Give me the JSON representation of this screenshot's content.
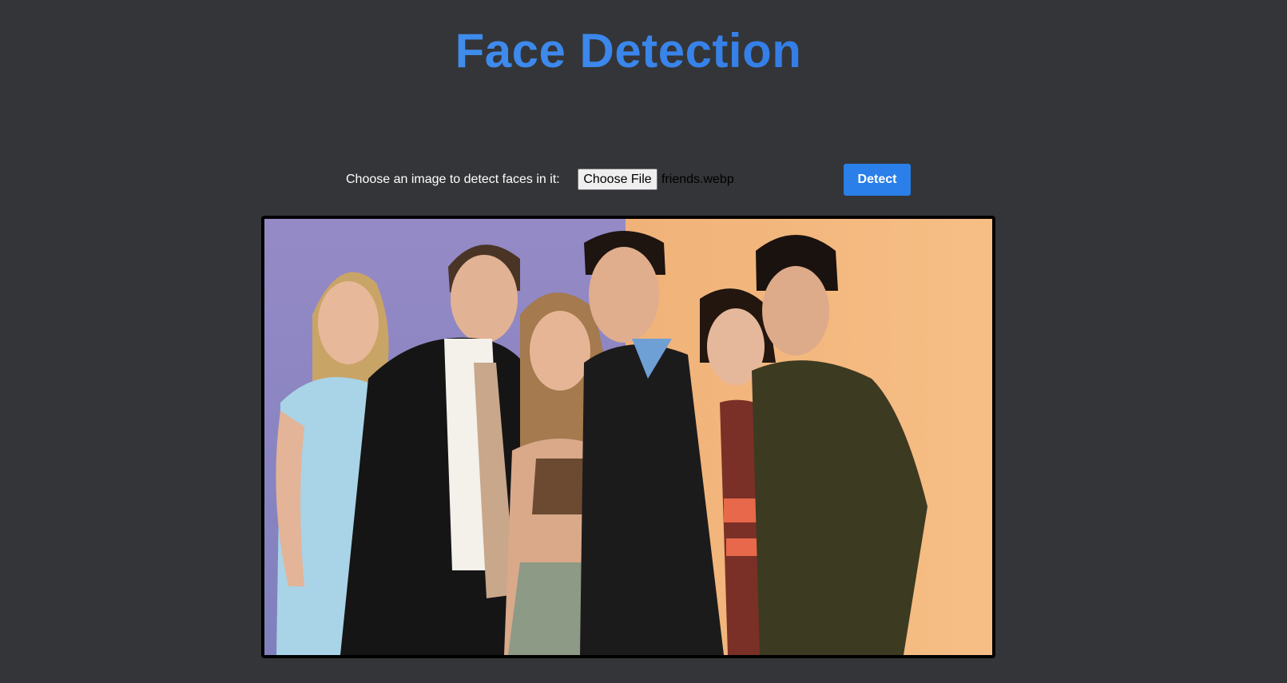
{
  "page": {
    "title": "Face Detection"
  },
  "form": {
    "prompt_label": "Choose an image to detect faces in it:",
    "choose_file_label": "Choose File",
    "selected_file": "friends.webp",
    "detect_label": "Detect"
  },
  "colors": {
    "background": "#343538",
    "title_gradient_start": "#4f9bf0",
    "title_gradient_end": "#1f66d9",
    "detect_button": "#2a7fe8",
    "image_frame": "#000000"
  }
}
